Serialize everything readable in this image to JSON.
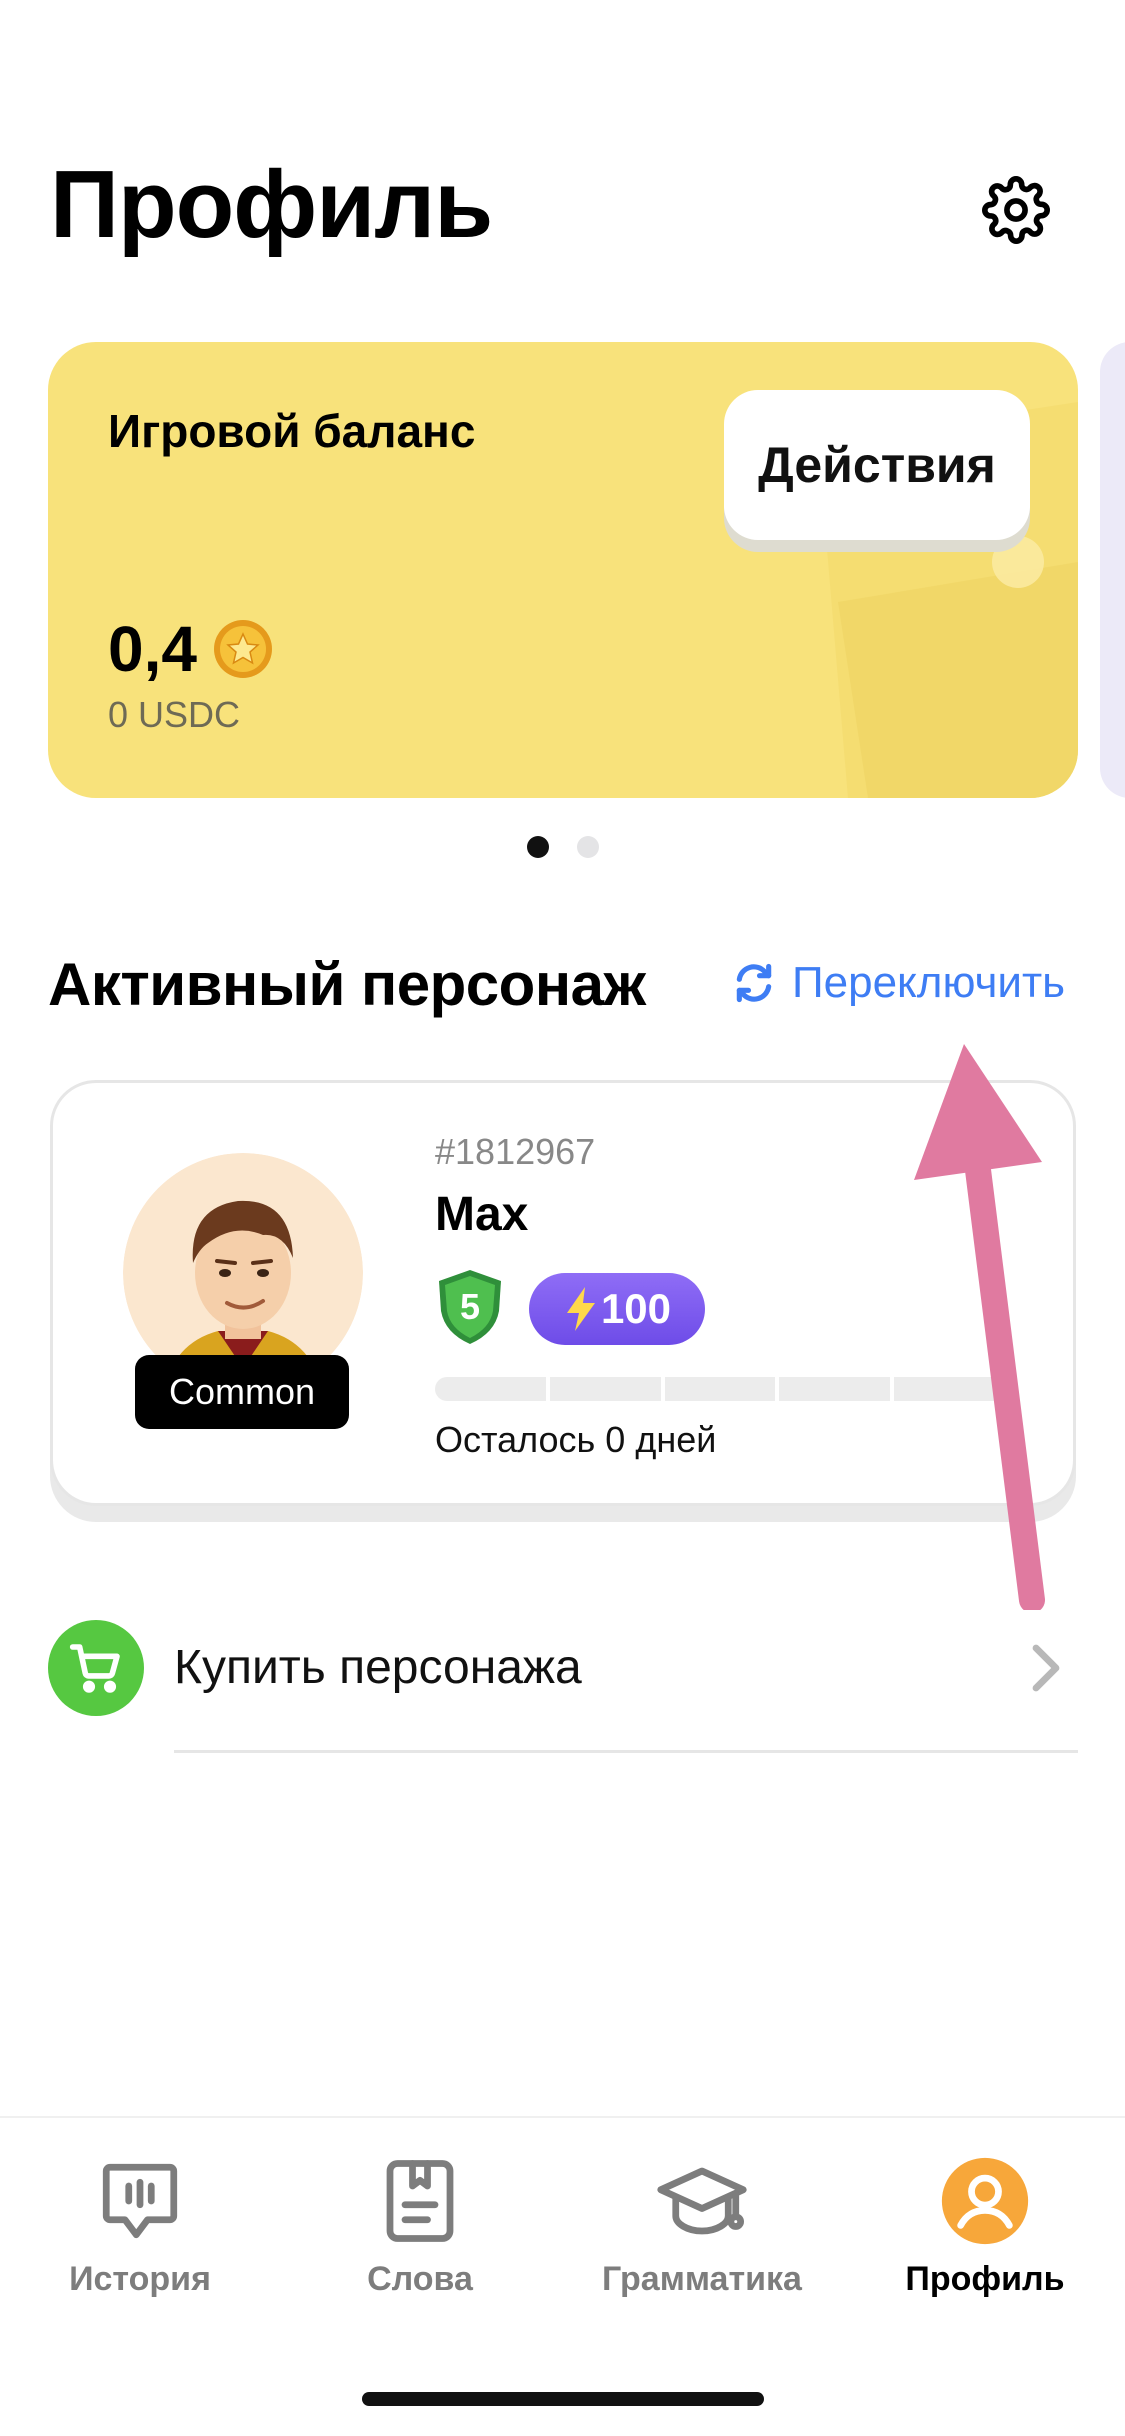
{
  "header": {
    "title": "Профиль",
    "settings_icon": "gear-icon"
  },
  "balance_card": {
    "label": "Игровой баланс",
    "actions_label": "Действия",
    "amount": "0,4",
    "usdc": "0 USDC",
    "coin_icon": "star-coin-icon",
    "color": "#f8e27b"
  },
  "pager": {
    "count": 2,
    "active_index": 0
  },
  "active_character": {
    "section_title": "Активный персонаж",
    "switch_label": "Переключить",
    "accent": "#3e7df4",
    "card": {
      "id": "#1812967",
      "name": "Max",
      "rarity": "Common",
      "level": "5",
      "energy": "100",
      "progress": 0,
      "days_left": "Осталось 0 дней"
    }
  },
  "buy_row": {
    "label": "Купить персонажа",
    "icon": "cart-icon",
    "icon_color": "#56c841"
  },
  "tabbar": {
    "items": [
      {
        "label": "История",
        "icon": "chat-bubble-icon",
        "active": false
      },
      {
        "label": "Слова",
        "icon": "notebook-icon",
        "active": false
      },
      {
        "label": "Грамматика",
        "icon": "graduation-cap-icon",
        "active": false
      },
      {
        "label": "Профиль",
        "icon": "profile-icon",
        "active": true
      }
    ]
  }
}
